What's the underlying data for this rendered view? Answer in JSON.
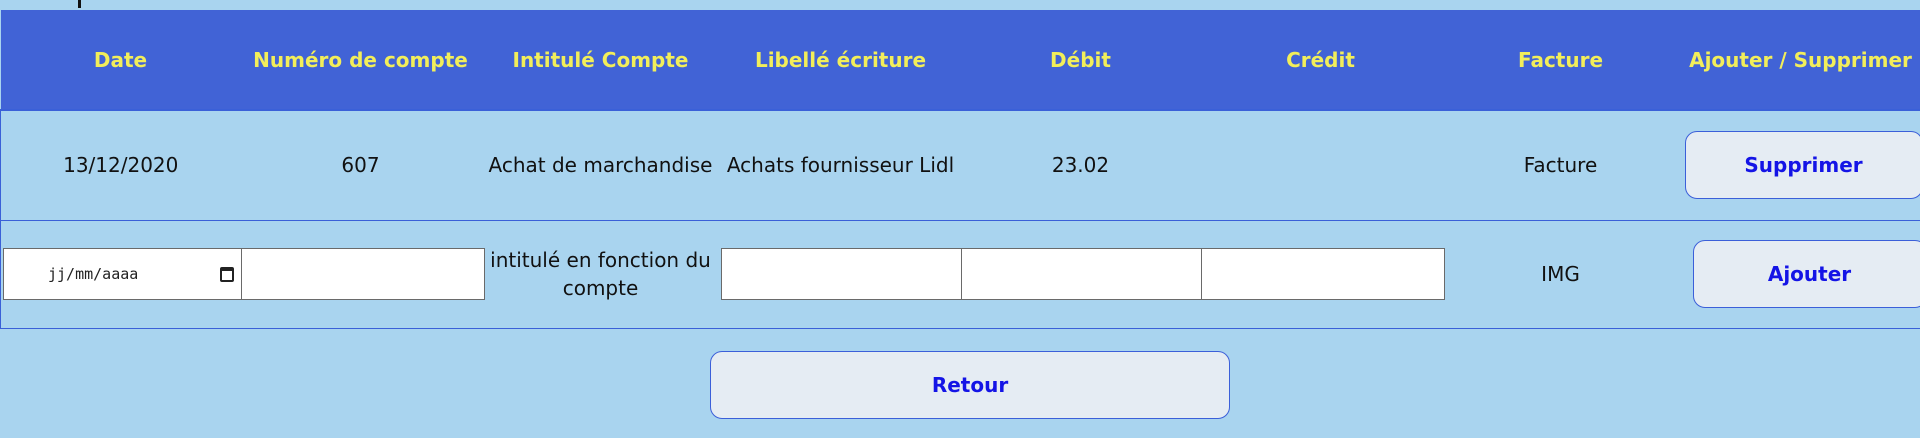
{
  "table": {
    "headers": [
      "Date",
      "Numéro de compte",
      "Intitulé Compte",
      "Libellé écriture",
      "Débit",
      "Crédit",
      "Facture",
      "Ajouter / Supprimer"
    ],
    "rows": [
      {
        "date": "13/12/2020",
        "account_number": "607",
        "account_title": "Achat de marchandise",
        "entry_label": "Achats fournisseur Lidl",
        "debit": "23.02",
        "credit": "",
        "invoice": "Facture",
        "action_label": "Supprimer"
      }
    ],
    "new_row": {
      "date_placeholder": "jj/mm/aaaa",
      "account_title_hint": "intitulé en fonction du compte",
      "invoice": "IMG",
      "action_label": "Ajouter"
    }
  },
  "footer": {
    "back_label": "Retour"
  }
}
